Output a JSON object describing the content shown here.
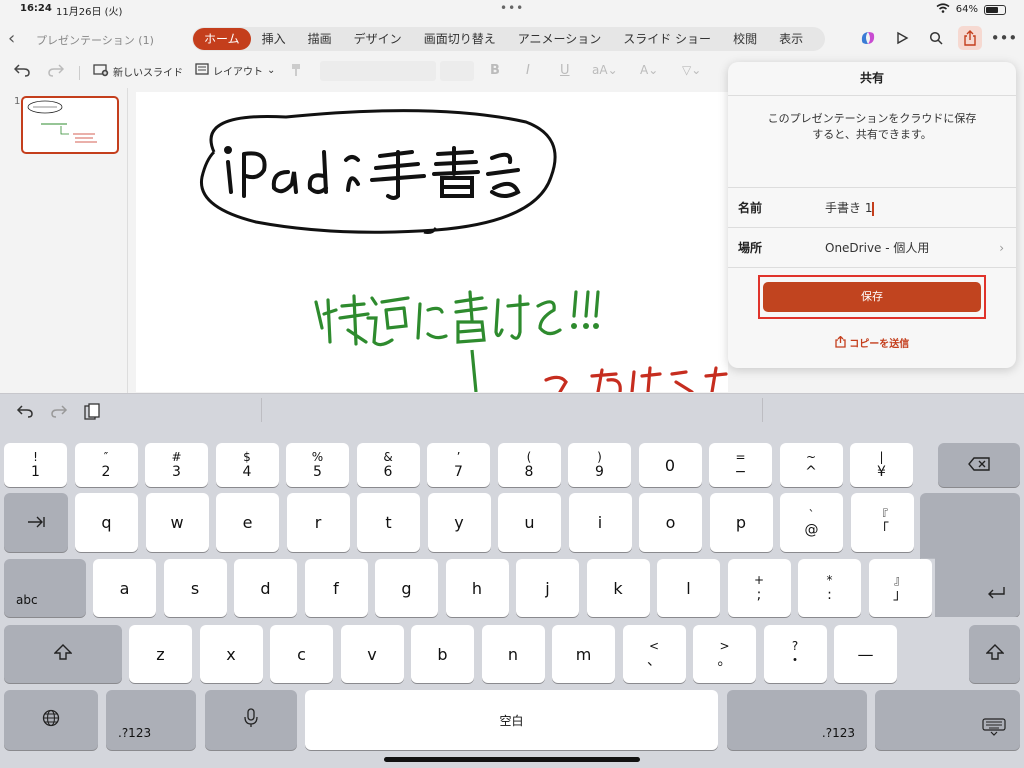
{
  "status": {
    "time": "16:24",
    "date": "11月26日 (火)",
    "battery": "64%",
    "battery_level": 0.64,
    "dots": "•••"
  },
  "header": {
    "doc_title": "プレゼンテーション (1)",
    "tabs": [
      "ホーム",
      "挿入",
      "描画",
      "デザイン",
      "画面切り替え",
      "アニメーション",
      "スライド ショー",
      "校閲",
      "表示"
    ],
    "active_tab": 0
  },
  "ribbon": {
    "new_slide": "新しいスライド",
    "layout": "レイアウト"
  },
  "slides": {
    "current_number": "1"
  },
  "share_panel": {
    "title": "共有",
    "description_line1": "このプレゼンテーションをクラウドに保存",
    "description_line2": "すると、共有できます。",
    "name_label": "名前",
    "name_value": "手書き 1",
    "location_label": "場所",
    "location_value": "OneDrive - 個人用",
    "save_label": "保存",
    "send_copy_label": "コピーを送信"
  },
  "keyboard": {
    "number_row": [
      {
        "top": "!",
        "bottom": "1"
      },
      {
        "top": "″",
        "bottom": "2"
      },
      {
        "top": "#",
        "bottom": "3"
      },
      {
        "top": "$",
        "bottom": "4"
      },
      {
        "top": "%",
        "bottom": "5"
      },
      {
        "top": "&",
        "bottom": "6"
      },
      {
        "top": "’",
        "bottom": "7"
      },
      {
        "top": "(",
        "bottom": "8"
      },
      {
        "top": ")",
        "bottom": "9"
      },
      {
        "top": "",
        "bottom": "0"
      },
      {
        "top": "=",
        "bottom": "−"
      },
      {
        "top": "~",
        "bottom": "^"
      },
      {
        "top": "|",
        "bottom": "¥"
      }
    ],
    "row_q": [
      {
        "top": "",
        "bottom": "q"
      },
      {
        "top": "",
        "bottom": "w"
      },
      {
        "top": "",
        "bottom": "e"
      },
      {
        "top": "",
        "bottom": "r"
      },
      {
        "top": "",
        "bottom": "t"
      },
      {
        "top": "",
        "bottom": "y"
      },
      {
        "top": "",
        "bottom": "u"
      },
      {
        "top": "",
        "bottom": "i"
      },
      {
        "top": "",
        "bottom": "o"
      },
      {
        "top": "",
        "bottom": "p"
      },
      {
        "top": "`",
        "bottom": "@"
      },
      {
        "top": "『",
        "bottom": "「"
      }
    ],
    "row_a": [
      {
        "top": "",
        "bottom": "a"
      },
      {
        "top": "",
        "bottom": "s"
      },
      {
        "top": "",
        "bottom": "d"
      },
      {
        "top": "",
        "bottom": "f"
      },
      {
        "top": "",
        "bottom": "g"
      },
      {
        "top": "",
        "bottom": "h"
      },
      {
        "top": "",
        "bottom": "j"
      },
      {
        "top": "",
        "bottom": "k"
      },
      {
        "top": "",
        "bottom": "l"
      },
      {
        "top": "+",
        "bottom": ";"
      },
      {
        "top": "*",
        "bottom": ":"
      },
      {
        "top": "』",
        "bottom": "」"
      }
    ],
    "row_z": [
      {
        "top": "",
        "bottom": "z"
      },
      {
        "top": "",
        "bottom": "x"
      },
      {
        "top": "",
        "bottom": "c"
      },
      {
        "top": "",
        "bottom": "v"
      },
      {
        "top": "",
        "bottom": "b"
      },
      {
        "top": "",
        "bottom": "n"
      },
      {
        "top": "",
        "bottom": "m"
      },
      {
        "top": "<",
        "bottom": "、"
      },
      {
        "top": ">",
        "bottom": "。"
      },
      {
        "top": "?",
        "bottom": "・"
      },
      {
        "top": "",
        "bottom": "—"
      }
    ],
    "abc_label": "abc",
    "numbers_label": ".?123",
    "space_label": "空白"
  },
  "colors": {
    "accent": "#c43e1c",
    "save_button": "#c1441f",
    "highlight": "#e0332b",
    "ink_green": "#2e8b2e",
    "ink_red": "#c62d1f"
  }
}
